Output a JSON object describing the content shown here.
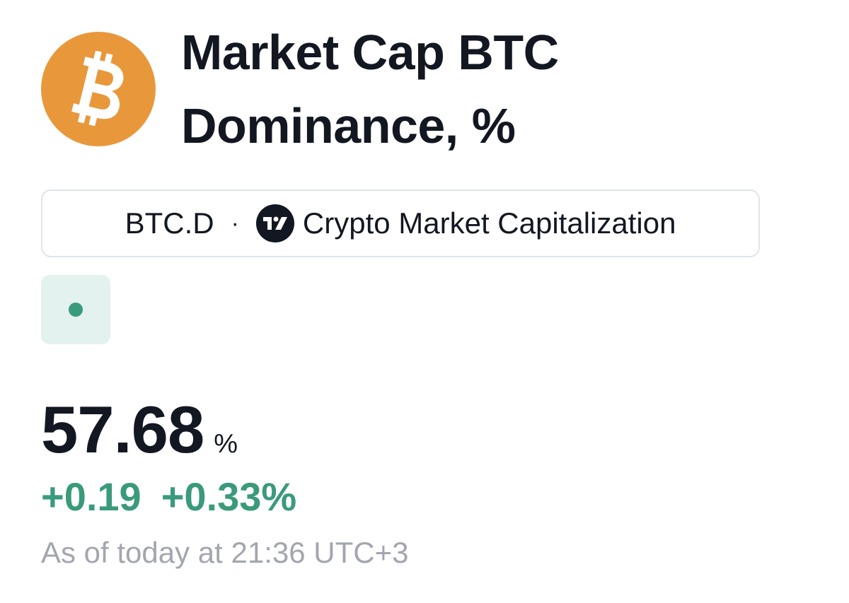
{
  "header": {
    "logo_icon": "bitcoin-logo-icon",
    "logo_color": "#E8983B",
    "title": "Market Cap BTC Dominance, %"
  },
  "symbol_chip": {
    "ticker": "BTC.D",
    "separator": "·",
    "source_icon": "tradingview-logo-icon",
    "source_name": "Crypto Market Capitalization"
  },
  "status": {
    "indicator_color": "#3A9A7C",
    "indicator_icon": "market-status-dot-icon"
  },
  "quote": {
    "value": "57.68",
    "unit": "%",
    "change": "+0.19",
    "change_percent": "+0.33%",
    "change_color": "#3A9A7C",
    "timestamp": "As of today at 21:36 UTC+3"
  }
}
